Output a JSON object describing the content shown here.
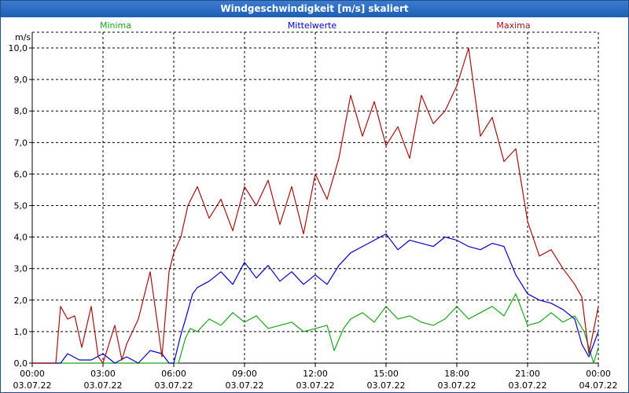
{
  "window": {
    "title": "Windgeschwindigkeit [m/s] skaliert"
  },
  "colors": {
    "min": "#1aa31a",
    "avg": "#0000c0",
    "max": "#a01010",
    "grid": "#000000",
    "axis": "#000000",
    "text": "#000000"
  },
  "chart_data": {
    "type": "line",
    "title": "Windgeschwindigkeit [m/s] skaliert",
    "ylabel": "m/s",
    "ylim": [
      0,
      10.5
    ],
    "y_ticks": [
      "0,0",
      "1,0",
      "2,0",
      "3,0",
      "4,0",
      "5,0",
      "6,0",
      "7,0",
      "8,0",
      "9,0",
      "10,0"
    ],
    "x_range_hours": [
      0,
      24
    ],
    "x_ticks": [
      {
        "time": "00:00",
        "date": "03.07.22"
      },
      {
        "time": "03:00",
        "date": "03.07.22"
      },
      {
        "time": "06:00",
        "date": "03.07.22"
      },
      {
        "time": "09:00",
        "date": "03.07.22"
      },
      {
        "time": "12:00",
        "date": "03.07.22"
      },
      {
        "time": "15:00",
        "date": "03.07.22"
      },
      {
        "time": "18:00",
        "date": "03.07.22"
      },
      {
        "time": "21:00",
        "date": "03.07.22"
      },
      {
        "time": "00:00",
        "date": "04.07.22"
      }
    ],
    "grid": true,
    "series": [
      {
        "name": "Minima",
        "color_key": "min",
        "x": [
          0,
          1.0,
          1.5,
          2.0,
          3.0,
          4.0,
          5.0,
          5.5,
          6.2,
          6.5,
          6.7,
          7.0,
          7.5,
          8.0,
          8.5,
          9.0,
          9.5,
          10.0,
          10.5,
          11.0,
          11.5,
          12.0,
          12.5,
          12.8,
          13.2,
          13.5,
          14.0,
          14.5,
          15.0,
          15.5,
          16.0,
          16.5,
          17.0,
          17.5,
          18.0,
          18.5,
          19.0,
          19.5,
          20.0,
          20.5,
          20.8,
          21.0,
          21.5,
          22.0,
          22.5,
          23.0,
          23.4,
          23.8,
          24.0
        ],
        "y": [
          0,
          0,
          0,
          0,
          0,
          0,
          0,
          0,
          0,
          0.8,
          1.1,
          1.0,
          1.4,
          1.2,
          1.6,
          1.3,
          1.5,
          1.1,
          1.2,
          1.3,
          1.0,
          1.1,
          1.2,
          0.4,
          1.1,
          1.4,
          1.6,
          1.3,
          1.8,
          1.4,
          1.5,
          1.3,
          1.2,
          1.4,
          1.8,
          1.4,
          1.6,
          1.8,
          1.5,
          2.2,
          1.6,
          1.2,
          1.3,
          1.6,
          1.3,
          1.5,
          1.0,
          0.0,
          0.5
        ]
      },
      {
        "name": "Mittelwerte",
        "color_key": "avg",
        "x": [
          0,
          1.0,
          1.2,
          1.5,
          2.0,
          2.5,
          3.0,
          3.5,
          4.0,
          4.5,
          5.0,
          5.5,
          5.8,
          6.0,
          6.3,
          6.5,
          6.8,
          7.0,
          7.5,
          8.0,
          8.5,
          9.0,
          9.5,
          10.0,
          10.5,
          11.0,
          11.5,
          12.0,
          12.5,
          13.0,
          13.5,
          14.0,
          14.5,
          15.0,
          15.5,
          16.0,
          16.5,
          17.0,
          17.5,
          18.0,
          18.5,
          19.0,
          19.5,
          20.0,
          20.5,
          21.0,
          21.5,
          22.0,
          22.5,
          23.0,
          23.3,
          23.6,
          24.0
        ],
        "y": [
          0,
          0,
          0,
          0.3,
          0.1,
          0.1,
          0.3,
          0.0,
          0.2,
          0.0,
          0.4,
          0.3,
          0.0,
          0.0,
          0.9,
          1.4,
          2.2,
          2.4,
          2.6,
          2.9,
          2.5,
          3.2,
          2.7,
          3.1,
          2.6,
          2.9,
          2.5,
          2.8,
          2.5,
          3.1,
          3.5,
          3.7,
          3.9,
          4.1,
          3.6,
          3.9,
          3.8,
          3.7,
          4.0,
          3.9,
          3.7,
          3.6,
          3.8,
          3.7,
          2.8,
          2.2,
          2.0,
          1.9,
          1.7,
          1.4,
          0.6,
          0.2,
          1.0
        ]
      },
      {
        "name": "Maxima",
        "color_key": "max",
        "x": [
          0,
          1.0,
          1.2,
          1.5,
          1.8,
          2.1,
          2.5,
          2.8,
          3.0,
          3.5,
          3.8,
          4.0,
          4.5,
          5.0,
          5.3,
          5.5,
          5.8,
          6.0,
          6.3,
          6.6,
          7.0,
          7.5,
          8.0,
          8.5,
          9.0,
          9.5,
          10.0,
          10.5,
          11.0,
          11.5,
          12.0,
          12.5,
          13.0,
          13.5,
          14.0,
          14.5,
          15.0,
          15.5,
          16.0,
          16.5,
          17.0,
          17.5,
          18.0,
          18.5,
          19.0,
          19.5,
          20.0,
          20.5,
          21.0,
          21.5,
          22.0,
          22.5,
          23.0,
          23.3,
          23.6,
          24.0
        ],
        "y": [
          0,
          0,
          1.8,
          1.4,
          1.5,
          0.5,
          1.8,
          0.2,
          0.0,
          1.2,
          0.1,
          0.6,
          1.4,
          2.9,
          1.3,
          0.2,
          2.9,
          3.5,
          4.0,
          5.0,
          5.6,
          4.6,
          5.2,
          4.2,
          5.6,
          5.0,
          5.8,
          4.4,
          5.6,
          4.1,
          6.0,
          5.2,
          6.5,
          8.5,
          7.2,
          8.3,
          6.9,
          7.5,
          6.5,
          8.5,
          7.6,
          8.0,
          8.8,
          10.0,
          7.2,
          7.8,
          6.4,
          6.8,
          4.5,
          3.4,
          3.6,
          3.0,
          2.5,
          2.1,
          0.3,
          1.8
        ]
      }
    ]
  }
}
